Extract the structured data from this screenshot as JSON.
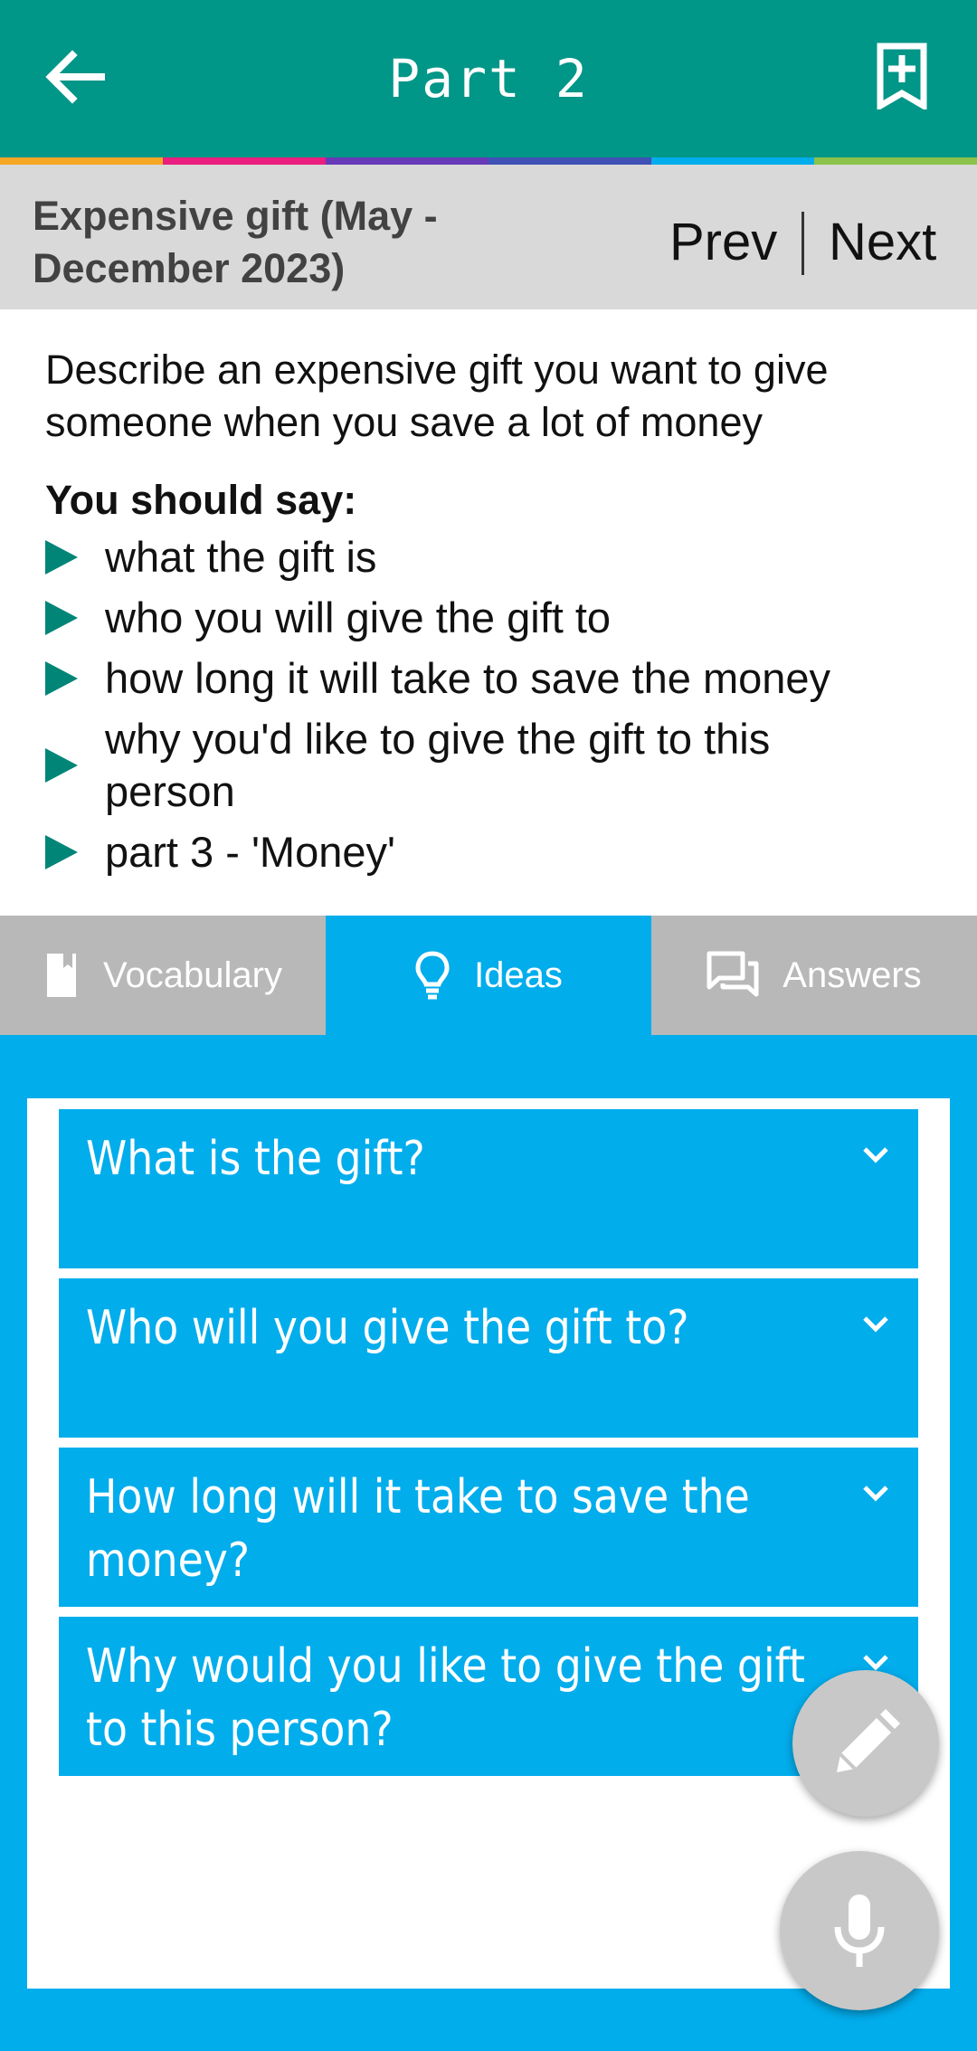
{
  "appbar": {
    "title": "Part 2"
  },
  "stripe_colors": [
    "#f5a623",
    "#e91e7e",
    "#673ab7",
    "#3f51b5",
    "#02adec",
    "#8bc34a"
  ],
  "topic": {
    "title_line1": "Expensive gift (May -",
    "title_line2": "December 2023)",
    "prev_label": "Prev",
    "next_label": "Next"
  },
  "question": {
    "text": "Describe an expensive gift you want to give someone when you save a lot of money",
    "should_say": "You should say:",
    "bullets": [
      "what the gift is",
      "who you will give the gift to",
      "how long it will take to save the money",
      "why you'd like to give the gift to this person",
      "part 3 - 'Money'"
    ]
  },
  "tabs": [
    {
      "label": "Vocabulary",
      "icon": "book-icon",
      "active": false
    },
    {
      "label": "Ideas",
      "icon": "lightbulb-icon",
      "active": true
    },
    {
      "label": "Answers",
      "icon": "chat-icon",
      "active": false
    }
  ],
  "accordion": [
    {
      "line1": "What is the gift?",
      "line2": ""
    },
    {
      "line1": "Who will you give the gift to?",
      "line2": ""
    },
    {
      "line1": "How long will it take to save the",
      "line2": "money?"
    },
    {
      "line1": "Why would you like to give the gift",
      "line2": "to this person?"
    }
  ],
  "fabs": {
    "edit_icon": "pencil-icon",
    "mic_icon": "microphone-icon"
  },
  "colors": {
    "appbar": "#009688",
    "accent": "#02adec",
    "bullet": "#008577",
    "tab_inactive": "#b8b8b8"
  }
}
